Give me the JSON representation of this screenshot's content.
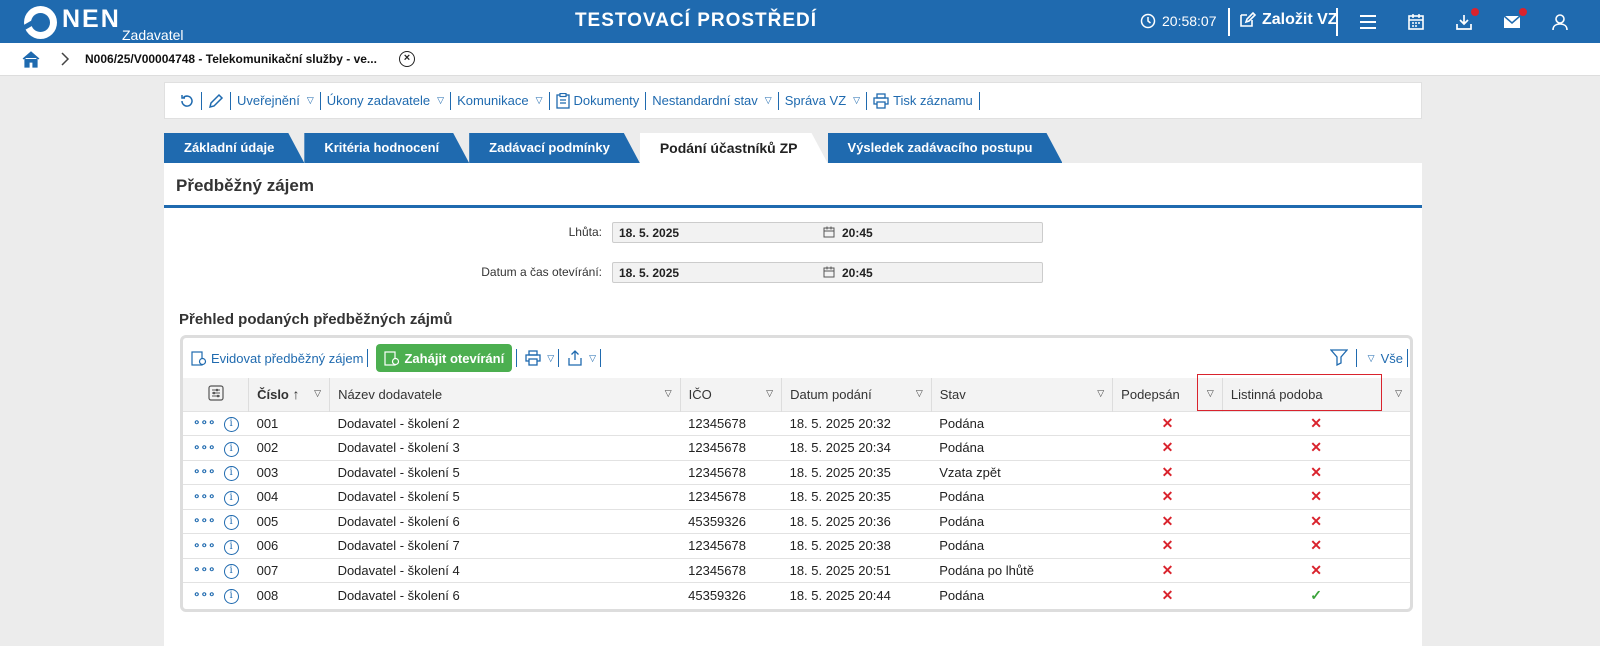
{
  "topbar": {
    "logo_text": "NEN",
    "logo_sub": "Zadavatel",
    "env_title": "TESTOVACÍ PROSTŘEDÍ",
    "time": "20:58:07",
    "new_label": "Založit VZ",
    "icons": [
      "clock-icon",
      "edit-icon",
      "menu-icon",
      "calendar-icon",
      "download-icon",
      "mail-icon",
      "user-icon"
    ]
  },
  "breadcrumb": {
    "text": "N006/25/V00004748 - Telekomunikační služby - ve...",
    "close": "×"
  },
  "toolbar": {
    "items": [
      "Uveřejnění",
      "Úkony zadavatele",
      "Komunikace",
      "Dokumenty",
      "Nestandardní stav",
      "Správa VZ",
      "Tisk záznamu"
    ]
  },
  "tabs": [
    "Základní údaje",
    "Kritéria hodnocení",
    "Zadávací podmínky",
    "Podání účastníků ZP",
    "Výsledek zadávacího postupu"
  ],
  "panel": {
    "title": "Předběžný zájem",
    "deadline_label": "Lhůta:",
    "deadline_date": "18. 5. 2025",
    "deadline_time": "20:45",
    "opening_label": "Datum a čas otevírání:",
    "opening_date": "18. 5. 2025",
    "opening_time": "20:45",
    "section_title": "Přehled podaných předběžných zájmů"
  },
  "grid": {
    "evidovat_label": "Evidovat předběžný zájem",
    "zahajit_label": "Zahájit otevírání",
    "all_label": "Vše",
    "columns": [
      "Číslo",
      "Název dodavatele",
      "IČO",
      "Datum podání",
      "Stav",
      "Podepsán",
      "Listinná podoba"
    ],
    "rows": [
      {
        "num": "001",
        "name": "Dodavatel - školení 2",
        "ico": "12345678",
        "date": "18. 5. 2025 20:32",
        "state": "Podána",
        "signed": "✕",
        "paper": "✕"
      },
      {
        "num": "002",
        "name": "Dodavatel - školení 3",
        "ico": "12345678",
        "date": "18. 5. 2025 20:34",
        "state": "Podána",
        "signed": "✕",
        "paper": "✕"
      },
      {
        "num": "003",
        "name": "Dodavatel - školení 5",
        "ico": "12345678",
        "date": "18. 5. 2025 20:35",
        "state": "Vzata zpět",
        "signed": "✕",
        "paper": "✕"
      },
      {
        "num": "004",
        "name": "Dodavatel - školení 5",
        "ico": "12345678",
        "date": "18. 5. 2025 20:35",
        "state": "Podána",
        "signed": "✕",
        "paper": "✕"
      },
      {
        "num": "005",
        "name": "Dodavatel - školení 6",
        "ico": "45359326",
        "date": "18. 5. 2025 20:36",
        "state": "Podána",
        "signed": "✕",
        "paper": "✕"
      },
      {
        "num": "006",
        "name": "Dodavatel - školení 7",
        "ico": "12345678",
        "date": "18. 5. 2025 20:38",
        "state": "Podána",
        "signed": "✕",
        "paper": "✕"
      },
      {
        "num": "007",
        "name": "Dodavatel - školení 4",
        "ico": "12345678",
        "date": "18. 5. 2025 20:51",
        "state": "Podána po lhůtě",
        "signed": "✕",
        "paper": "✕"
      },
      {
        "num": "008",
        "name": "Dodavatel - školení 6",
        "ico": "45359326",
        "date": "18. 5. 2025 20:44",
        "state": "Podána",
        "signed": "✕",
        "paper": "✓"
      }
    ]
  },
  "colors": {
    "brand": "#1f6aaf",
    "green": "#4caf50",
    "red": "#d9232d"
  }
}
